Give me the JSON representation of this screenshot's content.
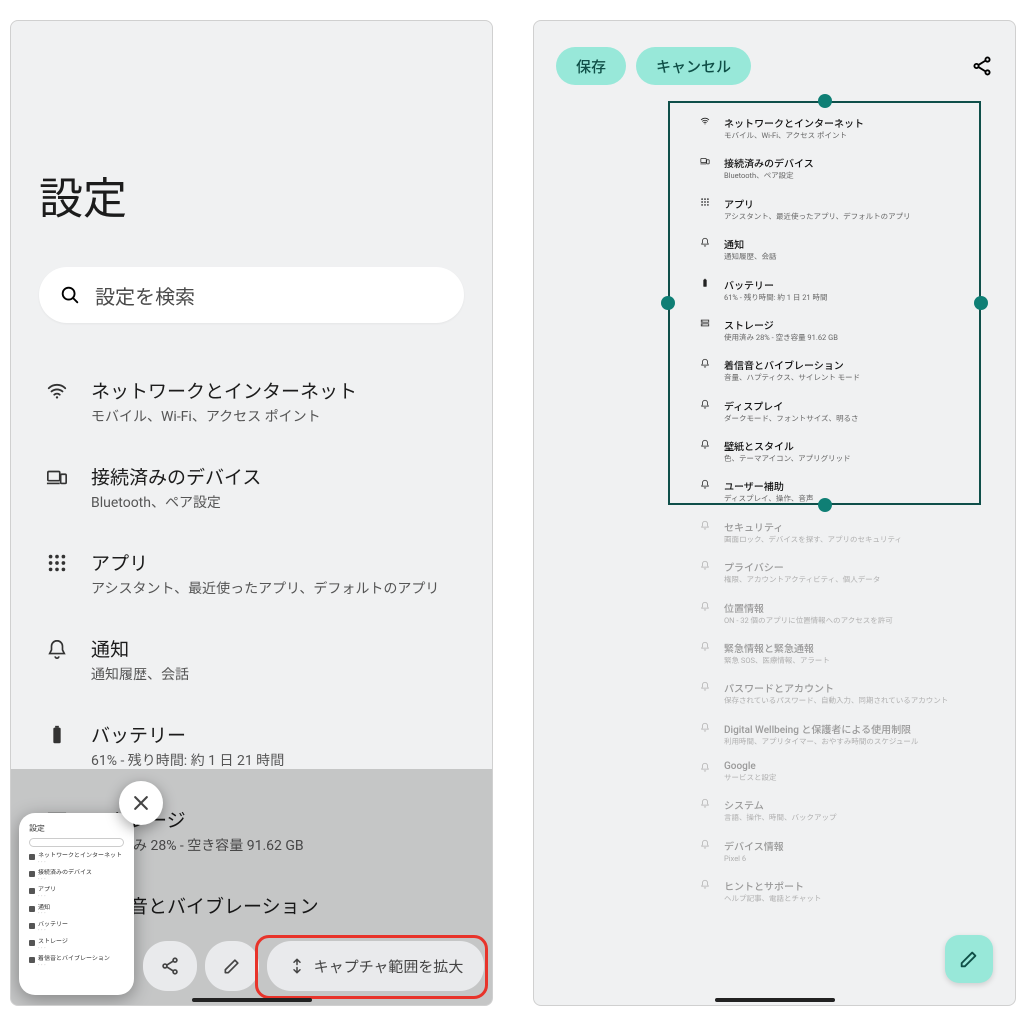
{
  "colors": {
    "teal": "#98e8d9",
    "tealDark": "#0f4f47",
    "red": "#e8332a"
  },
  "left": {
    "title": "設定",
    "search_placeholder": "設定を検索",
    "items": [
      {
        "icon": "wifi",
        "label": "ネットワークとインターネット",
        "sub": "モバイル、Wi‑Fi、アクセス ポイント"
      },
      {
        "icon": "devices",
        "label": "接続済みのデバイス",
        "sub": "Bluetooth、ペア設定"
      },
      {
        "icon": "apps",
        "label": "アプリ",
        "sub": "アシスタント、最近使ったアプリ、デフォルトのアプリ"
      },
      {
        "icon": "bell",
        "label": "通知",
        "sub": "通知履歴、会話"
      },
      {
        "icon": "battery",
        "label": "バッテリー",
        "sub": "61% - 残り時間: 約 1 日 21 時間"
      },
      {
        "icon": "storage",
        "label": "ストレージ",
        "sub": "使用済み 28% - 空き容量 91.62 GB"
      },
      {
        "icon": "sound",
        "label": "着信音とバイブレーション",
        "sub": ""
      }
    ],
    "toolbar": {
      "share": "共有",
      "edit": "編集",
      "expand": "キャプチャ範囲を拡大"
    },
    "thumbnail": {
      "title": "設定",
      "rows": [
        "ネットワークとインターネット",
        "接続済みのデバイス",
        "アプリ",
        "通知",
        "バッテリー",
        "ストレージ",
        "着信音とバイブレーション"
      ]
    }
  },
  "right": {
    "save": "保存",
    "cancel": "キャンセル",
    "items": [
      {
        "icon": "wifi",
        "label": "ネットワークとインターネット",
        "sub": "モバイル、Wi‑Fi、アクセス ポイント",
        "in": true
      },
      {
        "icon": "devices",
        "label": "接続済みのデバイス",
        "sub": "Bluetooth、ペア設定",
        "in": true
      },
      {
        "icon": "apps",
        "label": "アプリ",
        "sub": "アシスタント、最近使ったアプリ、デフォルトのアプリ",
        "in": true
      },
      {
        "icon": "bell",
        "label": "通知",
        "sub": "通知履歴、会話",
        "in": true
      },
      {
        "icon": "battery",
        "label": "バッテリー",
        "sub": "61% - 残り時間: 約 1 日 21 時間",
        "in": true
      },
      {
        "icon": "storage",
        "label": "ストレージ",
        "sub": "使用済み 28% - 空き容量 91.62 GB",
        "in": true
      },
      {
        "icon": "sound",
        "label": "着信音とバイブレーション",
        "sub": "音量、ハプティクス、サイレント モード",
        "in": true
      },
      {
        "icon": "display",
        "label": "ディスプレイ",
        "sub": "ダークモード、フォントサイズ、明るさ",
        "in": true
      },
      {
        "icon": "wall",
        "label": "壁紙とスタイル",
        "sub": "色、テーマアイコン、アプリグリッド",
        "in": true
      },
      {
        "icon": "a11y",
        "label": "ユーザー補助",
        "sub": "ディスプレイ、操作、音声",
        "in": true
      },
      {
        "icon": "lock",
        "label": "セキュリティ",
        "sub": "画面ロック、デバイスを探す、アプリのセキュリティ",
        "in": false
      },
      {
        "icon": "privacy",
        "label": "プライバシー",
        "sub": "権限、アカウントアクティビティ、個人データ",
        "in": false
      },
      {
        "icon": "location",
        "label": "位置情報",
        "sub": "ON - 32 個のアプリに位置情報へのアクセスを許可",
        "in": false
      },
      {
        "icon": "emerg",
        "label": "緊急情報と緊急通報",
        "sub": "緊急 SOS、医療情報、アラート",
        "in": false
      },
      {
        "icon": "key",
        "label": "パスワードとアカウント",
        "sub": "保存されているパスワード、自動入力、同期されているアカウント",
        "in": false
      },
      {
        "icon": "wellbe",
        "label": "Digital Wellbeing と保護者による使用制限",
        "sub": "利用時間、アプリタイマー、おやすみ時間のスケジュール",
        "in": false
      },
      {
        "icon": "google",
        "label": "Google",
        "sub": "サービスと設定",
        "in": false
      },
      {
        "icon": "system",
        "label": "システム",
        "sub": "言語、操作、時間、バックアップ",
        "in": false
      },
      {
        "icon": "about",
        "label": "デバイス情報",
        "sub": "Pixel 6",
        "in": false
      },
      {
        "icon": "help",
        "label": "ヒントとサポート",
        "sub": "ヘルプ記事、電話とチャット",
        "in": false
      }
    ]
  }
}
